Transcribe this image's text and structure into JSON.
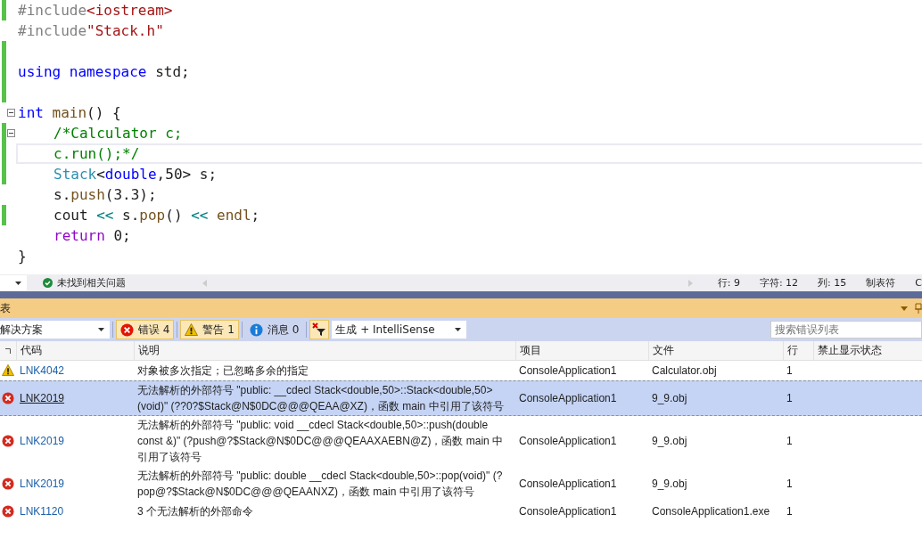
{
  "editor": {
    "lines": [
      {
        "changed": true,
        "current": false,
        "tokens": [
          {
            "kind": "pp",
            "text": "#include"
          },
          {
            "kind": "str",
            "text": "<iostream>"
          }
        ]
      },
      {
        "changed": false,
        "current": false,
        "tokens": [
          {
            "kind": "pp",
            "text": "#include"
          },
          {
            "kind": "str",
            "text": "\"Stack.h\""
          }
        ]
      },
      {
        "changed": true,
        "current": false
      },
      {
        "changed": true,
        "current": false,
        "tokens": [
          {
            "kind": "kw",
            "text": "using namespace"
          },
          {
            "kind": "plain",
            "text": " std;"
          }
        ]
      },
      {
        "changed": true,
        "current": false
      },
      {
        "changed": false,
        "current": false,
        "expanded": true,
        "tokens": [
          {
            "kind": "kw",
            "text": "int"
          },
          {
            "kind": "fn",
            "text": " main"
          },
          {
            "kind": "plain",
            "text": "() {"
          }
        ],
        "children": [
          {
            "changed": true,
            "current": false,
            "expanded": true,
            "tokens": [
              {
                "kind": "cmt",
                "text": "/*Calculator c;"
              }
            ]
          },
          {
            "changed": true,
            "current": true,
            "tokens": [
              {
                "kind": "cmt",
                "text": "c.run();*/"
              }
            ]
          },
          {
            "changed": true,
            "current": false,
            "tokens": [
              {
                "kind": "type",
                "text": "Stack"
              },
              {
                "kind": "plain",
                "text": "<"
              },
              {
                "kind": "kw",
                "text": "double"
              },
              {
                "kind": "plain",
                "text": ",50> s;"
              }
            ]
          },
          {
            "changed": false,
            "current": false,
            "tokens": [
              {
                "kind": "plain",
                "text": "s."
              },
              {
                "kind": "fn",
                "text": "push"
              },
              {
                "kind": "plain",
                "text": "(3.3);"
              }
            ]
          },
          {
            "changed": true,
            "current": false,
            "tokens": [
              {
                "kind": "plain",
                "text": "cout "
              },
              {
                "kind": "op",
                "text": "<<"
              },
              {
                "kind": "plain",
                "text": " s."
              },
              {
                "kind": "fn",
                "text": "pop"
              },
              {
                "kind": "plain",
                "text": "() "
              },
              {
                "kind": "op",
                "text": "<<"
              },
              {
                "kind": "fn",
                "text": " endl"
              },
              {
                "kind": "plain",
                "text": ";"
              }
            ]
          },
          {
            "changed": false,
            "current": false,
            "tokens": [
              {
                "kind": "ctrl",
                "text": "return"
              },
              {
                "kind": "plain",
                "text": " 0;"
              }
            ]
          }
        ]
      },
      {
        "changed": false,
        "current": false,
        "tokens": [
          {
            "kind": "plain",
            "text": "}"
          }
        ]
      }
    ]
  },
  "status_bar": {
    "message": "未找到相关问题",
    "fields": [
      "行: 9",
      "字符: 12",
      "列: 15",
      "制表符",
      "C"
    ]
  },
  "error_list": {
    "title": "表",
    "toolbar": {
      "scope": "解决方案",
      "buttons": [
        {
          "kind": "error",
          "label": "错误 4",
          "selected": true
        },
        {
          "kind": "warning",
          "label": "警告 1",
          "selected": true
        },
        {
          "kind": "info",
          "label": "消息 0",
          "selected": false
        }
      ],
      "filter_on": true,
      "source": "生成 + IntelliSense",
      "search": {
        "placeholder": "搜索错误列表"
      }
    },
    "columns": [
      "代码",
      "说明",
      "项目",
      "文件",
      "行",
      "禁止显示状态"
    ],
    "rows": [
      {
        "kind": "warning",
        "selected": false,
        "code": "LNK4042",
        "description": "对象被多次指定；已忽略多余的指定",
        "project": "ConsoleApplication1",
        "file": "Calculator.obj",
        "line": "1"
      },
      {
        "kind": "error",
        "selected": true,
        "code": "LNK2019",
        "description": "无法解析的外部符号 \"public: __cdecl Stack<double,50>::Stack<double,50>(void)\" (??0?$Stack@N$0DC@@@QEAA@XZ)，函数 main 中引用了该符号",
        "project": "ConsoleApplication1",
        "file": "9_9.obj",
        "line": "1"
      },
      {
        "kind": "error",
        "selected": false,
        "code": "LNK2019",
        "description": "无法解析的外部符号 \"public: void __cdecl Stack<double,50>::push(double const &)\" (?push@?$Stack@N$0DC@@@QEAAXAEBN@Z)，函数 main 中引用了该符号",
        "project": "ConsoleApplication1",
        "file": "9_9.obj",
        "line": "1"
      },
      {
        "kind": "error",
        "selected": false,
        "code": "LNK2019",
        "description": "无法解析的外部符号 \"public: double __cdecl Stack<double,50>::pop(void)\" (?pop@?$Stack@N$0DC@@@QEAANXZ)，函数 main 中引用了该符号",
        "project": "ConsoleApplication1",
        "file": "9_9.obj",
        "line": "1"
      },
      {
        "kind": "error",
        "selected": false,
        "code": "LNK1120",
        "description": "3 个无法解析的外部命令",
        "project": "ConsoleApplication1",
        "file": "ConsoleApplication1.exe",
        "line": "1"
      }
    ]
  }
}
